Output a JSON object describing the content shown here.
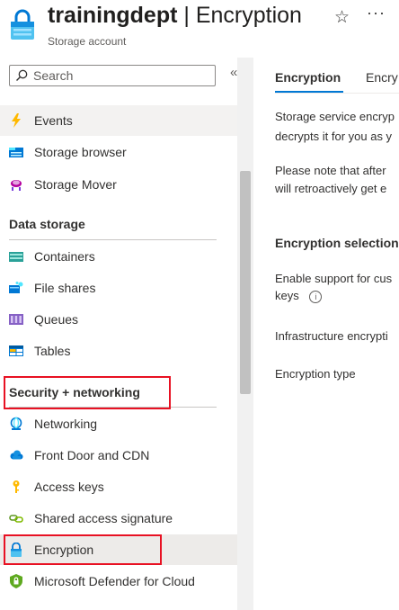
{
  "header": {
    "resource_name": "trainingdept",
    "separator": " | ",
    "page_name": "Encryption",
    "subtitle": "Storage account"
  },
  "sidebar": {
    "search": {
      "placeholder": "Search",
      "value": ""
    },
    "collapse_glyph": "«",
    "items_top": [
      {
        "label": "Events",
        "icon": "lightning-icon",
        "state": "hovered"
      },
      {
        "label": "Storage browser",
        "icon": "storage-browser-icon"
      },
      {
        "label": "Storage Mover",
        "icon": "storage-mover-icon"
      }
    ],
    "data_storage": {
      "title": "Data storage",
      "items": [
        {
          "label": "Containers",
          "icon": "containers-icon"
        },
        {
          "label": "File shares",
          "icon": "file-shares-icon"
        },
        {
          "label": "Queues",
          "icon": "queues-icon"
        },
        {
          "label": "Tables",
          "icon": "tables-icon"
        }
      ]
    },
    "security": {
      "title": "Security + networking",
      "items": [
        {
          "label": "Networking",
          "icon": "networking-icon"
        },
        {
          "label": "Front Door and CDN",
          "icon": "cloud-icon"
        },
        {
          "label": "Access keys",
          "icon": "key-icon"
        },
        {
          "label": "Shared access signature",
          "icon": "link-icon"
        },
        {
          "label": "Encryption",
          "icon": "lock-icon",
          "state": "selected"
        },
        {
          "label": "Microsoft Defender for Cloud",
          "icon": "shield-icon"
        }
      ]
    }
  },
  "content": {
    "tabs": [
      {
        "label": "Encryption",
        "active": true
      },
      {
        "label": "Encry",
        "active": false
      }
    ],
    "paragraph1": [
      "Storage service encryp",
      "decrypts it for you as y"
    ],
    "paragraph2": [
      "Please note that after",
      "will retroactively get e"
    ],
    "section_title": "Encryption selection",
    "fields": {
      "cmk_label": [
        "Enable support for cus",
        "keys"
      ],
      "infra_label": "Infrastructure encrypti",
      "type_label": "Encryption type"
    }
  },
  "colors": {
    "accent": "#0078d4",
    "highlight_box": "#e81123",
    "selected_bg": "#edebe9"
  }
}
